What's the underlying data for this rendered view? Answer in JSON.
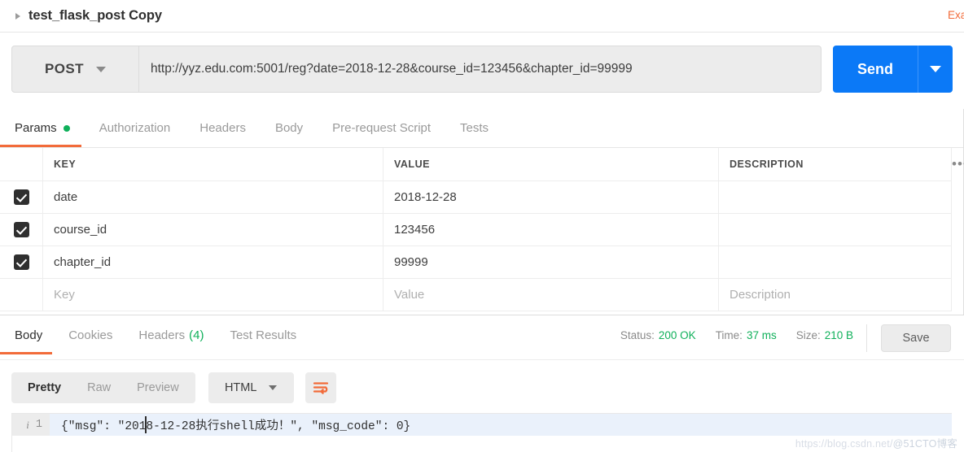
{
  "titlebar": {
    "request_name": "test_flask_post Copy",
    "examples_label": "Examples",
    "toggle_icon": "triangle-right-icon"
  },
  "url_row": {
    "method": "POST",
    "url": "http://yyz.edu.com:5001/reg?date=2018-12-28&course_id=123456&chapter_id=99999",
    "send_label": "Send",
    "send_color": "#0b79f7"
  },
  "request_tabs": [
    {
      "label": "Params",
      "active": true,
      "dot": true
    },
    {
      "label": "Authorization",
      "active": false,
      "dot": false
    },
    {
      "label": "Headers",
      "active": false,
      "dot": false
    },
    {
      "label": "Body",
      "active": false,
      "dot": false
    },
    {
      "label": "Pre-request Script",
      "active": false,
      "dot": false
    },
    {
      "label": "Tests",
      "active": false,
      "dot": false
    }
  ],
  "params_table": {
    "headers": {
      "key": "KEY",
      "value": "VALUE",
      "description": "DESCRIPTION",
      "more": "•••"
    },
    "rows": [
      {
        "checked": true,
        "key": "date",
        "value": "2018-12-28",
        "description": ""
      },
      {
        "checked": true,
        "key": "course_id",
        "value": "123456",
        "description": ""
      },
      {
        "checked": true,
        "key": "chapter_id",
        "value": "99999",
        "description": ""
      }
    ],
    "placeholder_row": {
      "key": "Key",
      "value": "Value",
      "description": "Description"
    }
  },
  "response_tabs": [
    {
      "label": "Body",
      "active": true,
      "count": ""
    },
    {
      "label": "Cookies",
      "active": false,
      "count": ""
    },
    {
      "label": "Headers",
      "active": false,
      "count": "(4)"
    },
    {
      "label": "Test Results",
      "active": false,
      "count": ""
    }
  ],
  "response_meta": {
    "status_label": "Status:",
    "status_value": "200 OK",
    "time_label": "Time:",
    "time_value": "37 ms",
    "size_label": "Size:",
    "size_value": "210 B",
    "value_color": "#0fb05a",
    "save_label": "Save"
  },
  "body_toolbar": {
    "views": [
      {
        "label": "Pretty",
        "active": true
      },
      {
        "label": "Raw",
        "active": false
      },
      {
        "label": "Preview",
        "active": false
      }
    ],
    "format": "HTML",
    "wrap_icon": "word-wrap-icon",
    "wrap_icon_color": "#f26b3a"
  },
  "response_body": {
    "line_number": "1",
    "info_icon": "info-icon",
    "content": "{\"msg\": \"2018-12-28执行shell成功！\", \"msg_code\": 0}"
  },
  "watermark": {
    "url": "https://blog.csdn.net/",
    "tag": "@51CTO博客"
  }
}
